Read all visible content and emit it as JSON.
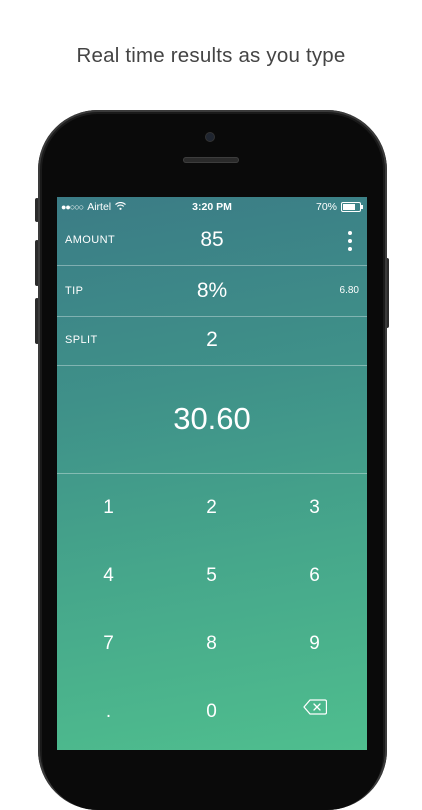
{
  "caption": "Real time results as you type",
  "status_bar": {
    "signal_dots": "●●○○○",
    "carrier": "Airtel",
    "time": "3:20 PM",
    "battery_percent": "70%",
    "battery_level": 0.7
  },
  "fields": {
    "amount": {
      "label": "AMOUNT",
      "value": "85"
    },
    "tip": {
      "label": "TIP",
      "value": "8%",
      "extra": "6.80"
    },
    "split": {
      "label": "SPLIT",
      "value": "2"
    }
  },
  "result": "30.60",
  "keypad": {
    "keys": [
      "1",
      "2",
      "3",
      "4",
      "5",
      "6",
      "7",
      "8",
      "9",
      ".",
      "0"
    ],
    "backspace_icon": "backspace-icon"
  },
  "colors": {
    "gradient_top": "#3b7c86",
    "gradient_bottom": "#4fbe8e",
    "text": "#ffffff"
  }
}
